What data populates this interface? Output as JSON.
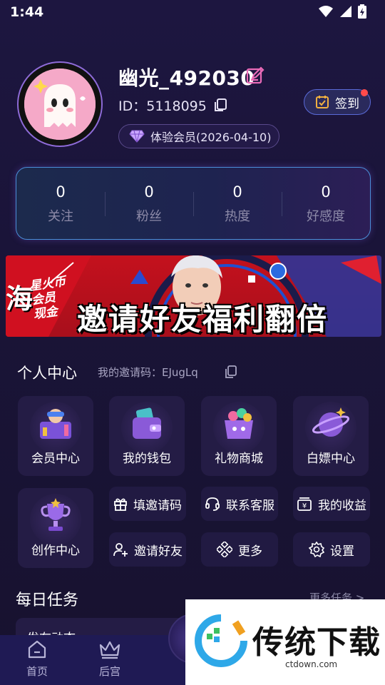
{
  "status": {
    "time": "1:44"
  },
  "profile": {
    "username": "幽光_492030",
    "id_text": "ID：5118095",
    "membership": "体验会员(2026-04-10)"
  },
  "checkin": {
    "label": "签到"
  },
  "stats": [
    {
      "value": "0",
      "label": "关注"
    },
    {
      "value": "0",
      "label": "粉丝"
    },
    {
      "value": "0",
      "label": "热度"
    },
    {
      "value": "0",
      "label": "好感度"
    }
  ],
  "banner": {
    "title": "邀请好友福利翻倍",
    "side_text_1": "星火币",
    "side_text_2": "会员",
    "side_text_3": "现金",
    "left_char": "海"
  },
  "personal": {
    "title": "个人中心",
    "invite_code_label": "我的邀请码：EJugLq"
  },
  "tiles": [
    {
      "label": "会员中心",
      "icon": "vip-center-icon"
    },
    {
      "label": "我的钱包",
      "icon": "wallet-icon"
    },
    {
      "label": "礼物商城",
      "icon": "gift-shop-icon"
    },
    {
      "label": "白嫖中心",
      "icon": "planet-icon"
    },
    {
      "label": "创作中心",
      "icon": "trophy-icon"
    }
  ],
  "small_buttons": [
    {
      "label": "填邀请码",
      "icon": "gift-box-icon"
    },
    {
      "label": "联系客服",
      "icon": "headset-icon"
    },
    {
      "label": "我的收益",
      "icon": "income-icon"
    },
    {
      "label": "邀请好友",
      "icon": "add-user-icon"
    },
    {
      "label": "更多",
      "icon": "grid-diamond-icon"
    },
    {
      "label": "设置",
      "icon": "gear-icon"
    }
  ],
  "daily": {
    "title": "每日任务",
    "more": "更多任务 >",
    "first_task": "发布动态"
  },
  "tabbar": [
    {
      "label": "首页",
      "icon": "home-icon"
    },
    {
      "label": "后宫",
      "icon": "crown-icon"
    }
  ],
  "watermark": {
    "brand": "传统下载",
    "url": "ctdown.com"
  },
  "colors": {
    "accent": "#5a6ad8",
    "background": "#1d1640",
    "badge_dot": "#ff4b4b"
  }
}
